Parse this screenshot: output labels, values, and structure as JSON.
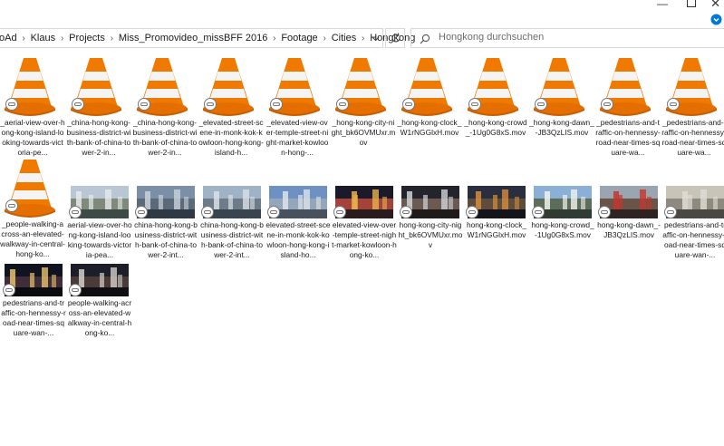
{
  "window": {
    "minimize": "—",
    "close": "✕"
  },
  "breadcrumb": {
    "items": [
      "oAd",
      "Klaus",
      "Projects",
      "Miss_Promovideo_missBFF 2016",
      "Footage",
      "Cities",
      "Hongkong"
    ]
  },
  "search": {
    "placeholder": "Hongkong durchsuchen"
  },
  "files": {
    "vlc_row1": [
      "_aerial-view-over-hong-kong-island-looking-towards-victoria-pe...",
      "_china-hong-kong-business-district-with-bank-of-china-tower-2-in...",
      "_china-hong-kong-business-district-with-bank-of-china-tower-2-in...",
      "_elevated-street-scene-in-monk-kok-kowloon-hong-kong-island-h...",
      "_elevated-view-over-temple-street-night-market-kowloon-hong-...",
      "_hong-kong-city-night_bk6OVMUxr.mov",
      "_hong-kong-clock_W1rNGGlxH.mov",
      "_hong-kong-crowd_-1Ug0G8xS.mov",
      "_hong-kong-dawn_-JB3QzLIS.mov",
      "_pedestrians-and-traffic-on-hennessy-road-near-times-square-wa...",
      "_pedestrians-and-traffic-on-hennessy-road-near-times-square-wa..."
    ],
    "vlc_row2_first": "_people-walking-across-an-elevated-walkway-in-central-hong-ko...",
    "photo_row2": [
      "aerial-view-over-hong-kong-island-looking-towards-victoria-pea...",
      "china-hong-kong-business-district-with-bank-of-china-tower-2-int...",
      "china-hong-kong-business-district-with-bank-of-china-tower-2-int...",
      "elevated-street-scene-in-monk-kok-kowloon-hong-kong-island-ho...",
      "elevated-view-over-temple-street-night-market-kowloon-hong-ko...",
      "hong-kong-city-night_bk6OVMUxr.mov",
      "hong-kong-clock_W1rNGGlxH.mov",
      "hong-kong-crowd_-1Ug0G8xS.mov",
      "hong-kong-dawn_-JB3QzLIS.mov",
      "pedestrians-and-traffic-on-hennessy-road-near-times-square-wan-..."
    ],
    "photo_row3": [
      "pedestrians-and-traffic-on-hennessy-road-near-times-square-wan-...",
      "people-walking-across-an-elevated-walkway-in-central-hong-ko..."
    ]
  },
  "colors": {
    "cone_orange": "#f07a00",
    "cone_white": "#f2f2f2",
    "accent": "#0078d7"
  }
}
